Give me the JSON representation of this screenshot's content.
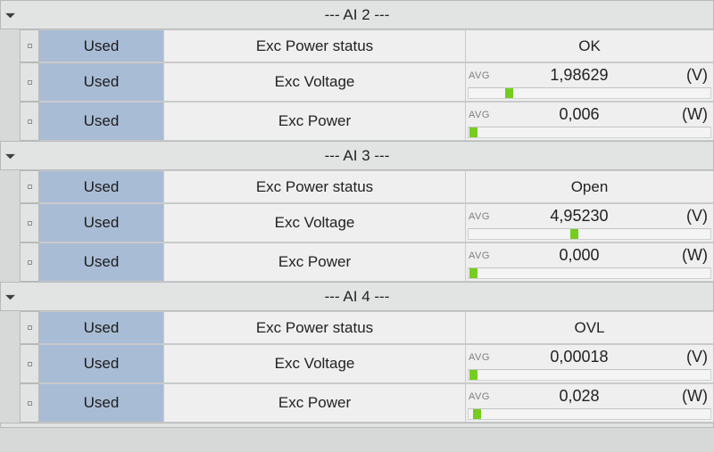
{
  "groups": [
    {
      "title": "--- AI 2 ---",
      "rows": [
        {
          "used_label": "Used",
          "name": "Exc Power status",
          "kind": "status",
          "status": "OK"
        },
        {
          "used_label": "Used",
          "name": "Exc Voltage",
          "kind": "measure",
          "avg_label": "AVG",
          "value": "1,98629",
          "unit": "(V)",
          "bar_pct": 15
        },
        {
          "used_label": "Used",
          "name": "Exc Power",
          "kind": "measure",
          "avg_label": "AVG",
          "value": "0,006",
          "unit": "(W)",
          "bar_pct": 0.5
        }
      ]
    },
    {
      "title": "--- AI 3 ---",
      "rows": [
        {
          "used_label": "Used",
          "name": "Exc Power status",
          "kind": "status",
          "status": "Open"
        },
        {
          "used_label": "Used",
          "name": "Exc Voltage",
          "kind": "measure",
          "avg_label": "AVG",
          "value": "4,95230",
          "unit": "(V)",
          "bar_pct": 42
        },
        {
          "used_label": "Used",
          "name": "Exc Power",
          "kind": "measure",
          "avg_label": "AVG",
          "value": "0,000",
          "unit": "(W)",
          "bar_pct": 0.5
        }
      ]
    },
    {
      "title": "--- AI 4 ---",
      "rows": [
        {
          "used_label": "Used",
          "name": "Exc Power status",
          "kind": "status",
          "status": "OVL"
        },
        {
          "used_label": "Used",
          "name": "Exc Voltage",
          "kind": "measure",
          "avg_label": "AVG",
          "value": "0,00018",
          "unit": "(V)",
          "bar_pct": 0.5
        },
        {
          "used_label": "Used",
          "name": "Exc Power",
          "kind": "measure",
          "avg_label": "AVG",
          "value": "0,028",
          "unit": "(W)",
          "bar_pct": 2
        }
      ]
    }
  ]
}
